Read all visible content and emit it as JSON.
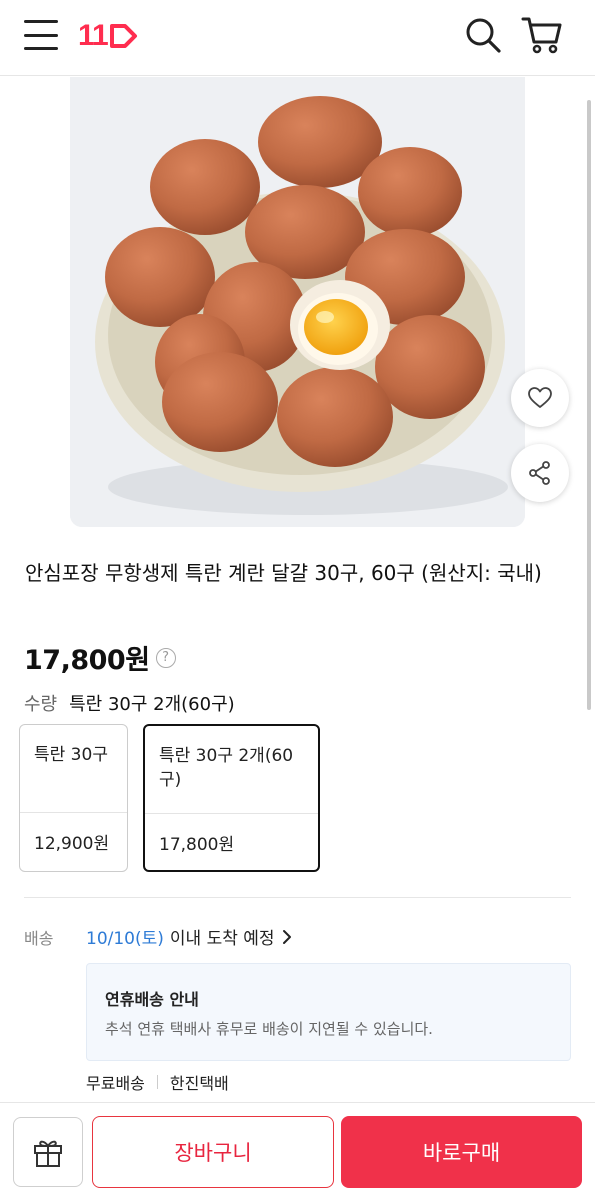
{
  "header": {
    "logo_text": "11",
    "brand_color": "#ff2d4f",
    "icons": [
      "menu-icon",
      "search-icon",
      "cart-icon"
    ]
  },
  "product": {
    "image_description_icon": "egg-bowl-image",
    "title": "안심포장 무항생제 특란 계란 달걀 30구, 60구 (원산지: 국내)",
    "price": "17,800원",
    "price_help": "?"
  },
  "options": {
    "quantity_label": "수량",
    "quantity_value": "특란 30구 2개(60구)",
    "items": [
      {
        "name": "특란 30구",
        "price": "12,900원",
        "selected": false
      },
      {
        "name": "특란 30구 2개(60구)",
        "price": "17,800원",
        "selected": true
      }
    ]
  },
  "delivery": {
    "label": "배송",
    "date": "10/10(토)",
    "date_suffix": "이내 도착 예정",
    "date_color": "#2e7bd6",
    "notice_title": "연휴배송 안내",
    "notice_body": "추석 연휴 택배사 휴무로 배송이 지연될 수 있습니다.",
    "shipping_fee": "무료배송",
    "carrier": "한진택배"
  },
  "bottom_bar": {
    "cart_label": "장바구니",
    "buy_label": "바로구매",
    "accent_color": "#f0314a"
  }
}
